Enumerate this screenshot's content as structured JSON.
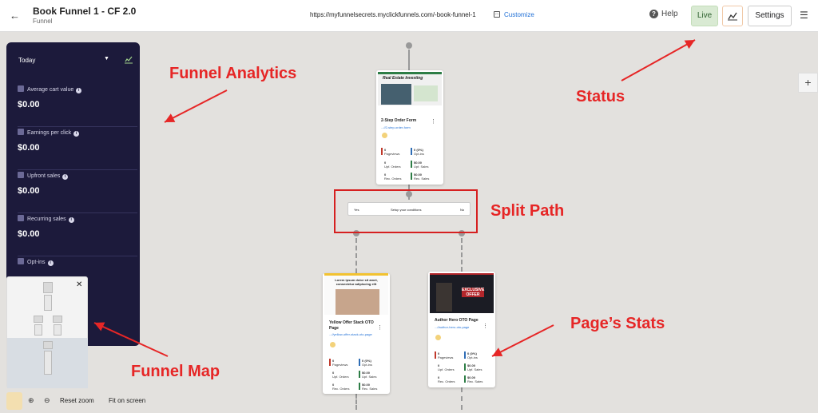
{
  "header": {
    "back_icon": "arrow-left-icon",
    "title": "Book Funnel 1 - CF 2.0",
    "subtitle": "Funnel",
    "url": "https://myfunnelsecrets.myclickfunnels.com/-book-funnel-1",
    "customize_label": "Customize",
    "help_label": "Help",
    "status_label": "Live",
    "settings_label": "Settings"
  },
  "analytics": {
    "period": "Today",
    "items": [
      {
        "label": "Average cart value",
        "value": "$0.00"
      },
      {
        "label": "Earnings per click",
        "value": "$0.00"
      },
      {
        "label": "Upfront sales",
        "value": "$0.00"
      },
      {
        "label": "Recurring sales",
        "value": "$0.00"
      },
      {
        "label": "Opt-ins",
        "value": ""
      }
    ]
  },
  "zoom": {
    "reset_label": "Reset zoom",
    "fit_label": "Fit on screen"
  },
  "cards": [
    {
      "hero_text": "Real Estate Investing",
      "name": "2-Step Order Form",
      "path": "...//2-step-order-form",
      "stats": [
        {
          "value": "0",
          "label": "Pageviews"
        },
        {
          "value": "0 (0%)",
          "label": "Opt-ins"
        },
        {
          "value": "0",
          "label": "Upf. Orders"
        },
        {
          "value": "$0.00",
          "label": "Upf. Sales"
        },
        {
          "value": "0",
          "label": "Rec. Orders"
        },
        {
          "value": "$0.00",
          "label": "Rec. Sales"
        }
      ]
    },
    {
      "hero_text": "Lorem ipsum dolor sit amet, consectetur adipiscing elit",
      "name": "Yellow Offer Stack OTO Page",
      "path": "...//yellow-offer-stack-oto-page",
      "stats": [
        {
          "value": "0",
          "label": "Pageviews"
        },
        {
          "value": "0 (0%)",
          "label": "Opt-ins"
        },
        {
          "value": "0",
          "label": "Upf. Orders"
        },
        {
          "value": "$0.00",
          "label": "Upf. Sales"
        },
        {
          "value": "0",
          "label": "Rec. Orders"
        },
        {
          "value": "$0.00",
          "label": "Rec. Sales"
        }
      ]
    },
    {
      "hero_text": "EXCLUSIVE OFFER",
      "name": "Author Hero OTO Page",
      "path": "...//author-hero-oto-page",
      "stats": [
        {
          "value": "0",
          "label": "Pageviews"
        },
        {
          "value": "0 (0%)",
          "label": "Opt-ins"
        },
        {
          "value": "0",
          "label": "Upf. Orders"
        },
        {
          "value": "$0.00",
          "label": "Upf. Sales"
        },
        {
          "value": "0",
          "label": "Rec. Orders"
        },
        {
          "value": "$0.00",
          "label": "Rec. Sales"
        }
      ]
    }
  ],
  "split": {
    "yes_label": "Yes",
    "setup_label": "Setup your conditions",
    "no_label": "No"
  },
  "annotations": {
    "analytics": "Funnel Analytics",
    "status": "Status",
    "split": "Split Path",
    "stats": "Page’s Stats",
    "map": "Funnel Map"
  },
  "colors": {
    "accent": "#e62626",
    "panel": "#1c1a3b",
    "live": "#d9ead3",
    "link": "#1f6fd6"
  }
}
